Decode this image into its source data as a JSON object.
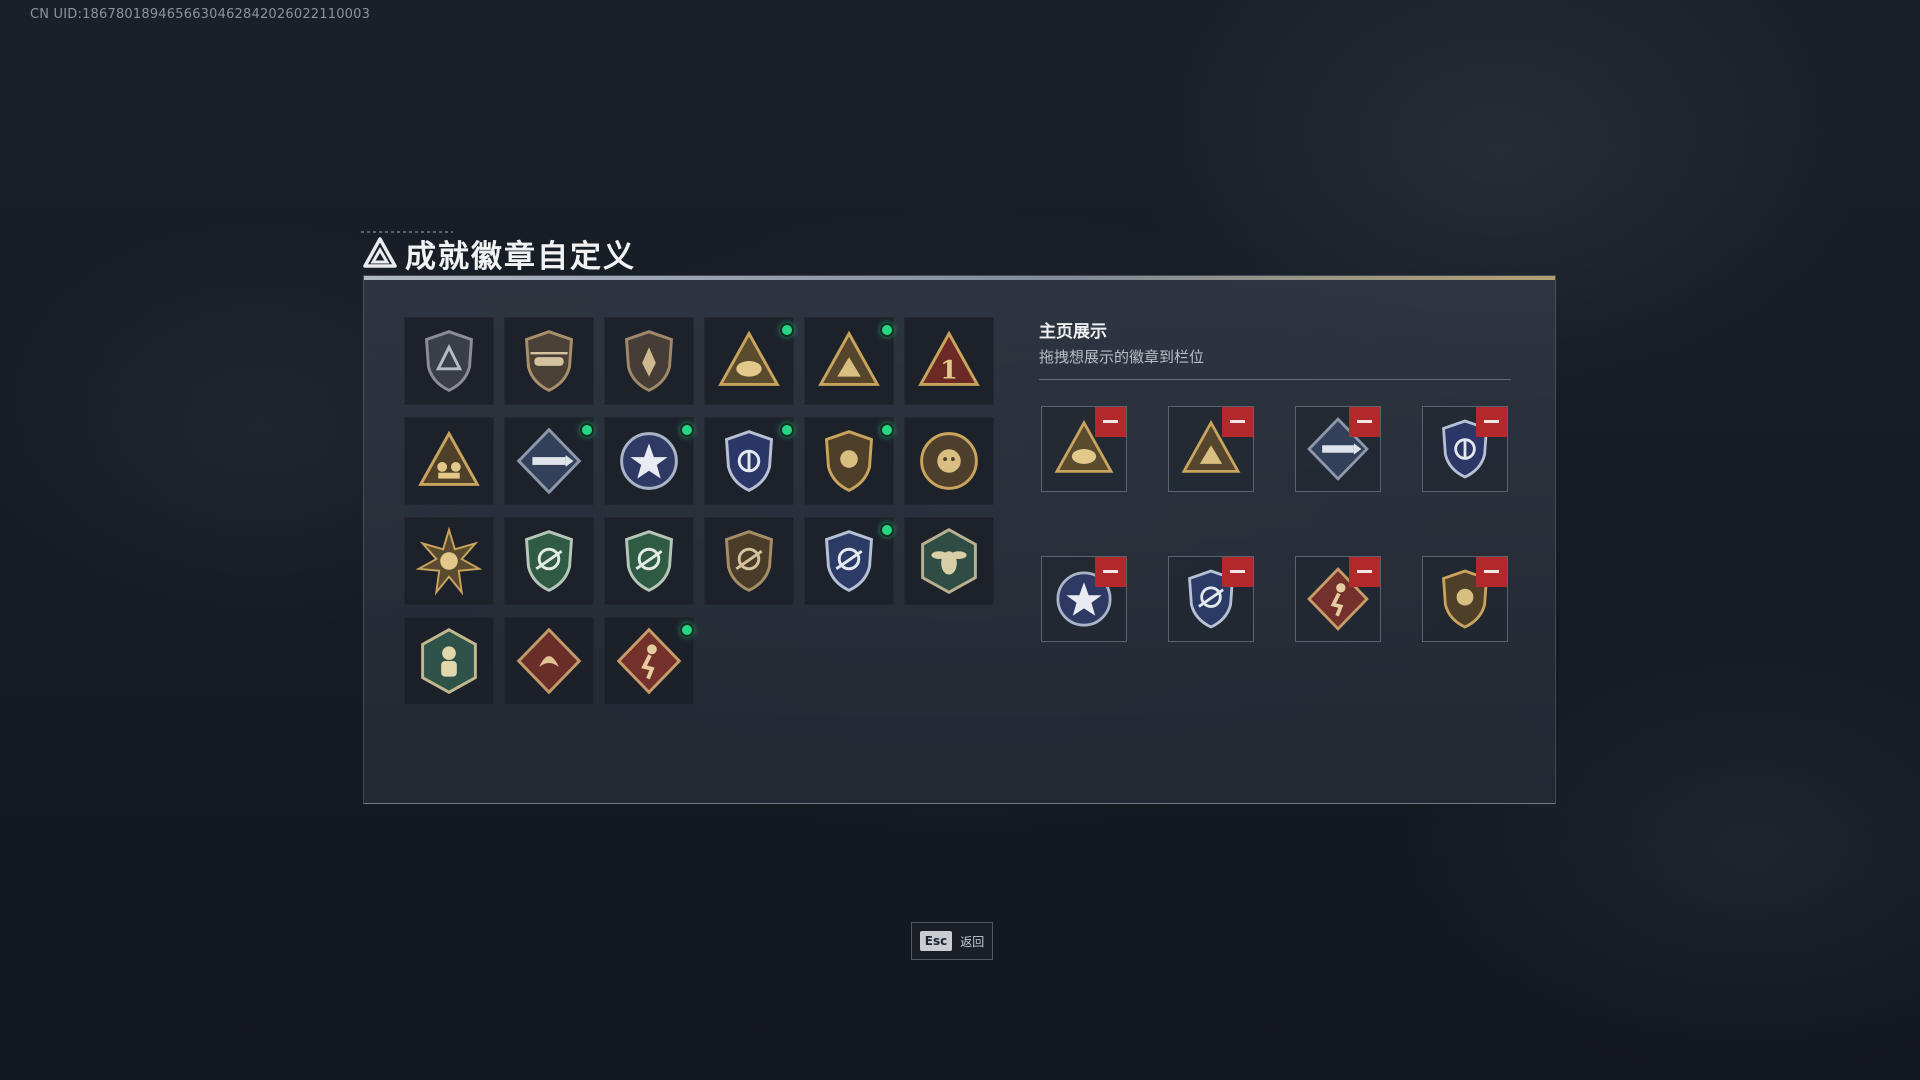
{
  "uid_text": "CN UID:1867801894656630462842026022110003",
  "header": {
    "title": "成就徽章自定义",
    "logo_icon": "triangle-logo-icon"
  },
  "colors": {
    "new_dot": "#27d685",
    "remove": "#b3282b",
    "gold": "#c9a45c",
    "steel": "#8d99ab"
  },
  "badge_grid": {
    "items": [
      {
        "icon": "shield-triangle-badge-icon",
        "new": false
      },
      {
        "icon": "helicopter-badge-icon",
        "new": false
      },
      {
        "icon": "shield-wings-badge-icon",
        "new": false
      },
      {
        "icon": "triangle-helmet-badge-icon",
        "new": true
      },
      {
        "icon": "triangle-soldier-badge-icon",
        "new": true
      },
      {
        "icon": "triangle-number-one-badge-icon",
        "new": false
      },
      {
        "icon": "triangle-squad-badge-icon",
        "new": false
      },
      {
        "icon": "diamond-rocket-badge-icon",
        "new": true
      },
      {
        "icon": "star-emblem-badge-icon",
        "new": true
      },
      {
        "icon": "blue-shield-emblem-badge-icon",
        "new": true
      },
      {
        "icon": "gold-shield-badge-icon",
        "new": true
      },
      {
        "icon": "round-beast-badge-icon",
        "new": false
      },
      {
        "icon": "sunburst-badge-icon",
        "new": false
      },
      {
        "icon": "green-shield-rifle-badge-icon",
        "new": false
      },
      {
        "icon": "green-shield-rifle-badge-icon",
        "new": false
      },
      {
        "icon": "bronze-shield-rifle-badge-icon",
        "new": false
      },
      {
        "icon": "blue-shield-rifle-badge-icon",
        "new": true
      },
      {
        "icon": "hexagon-wasp-badge-icon",
        "new": false
      },
      {
        "icon": "hexagon-figure-badge-icon",
        "new": false
      },
      {
        "icon": "diamond-dragon-badge-icon",
        "new": false
      },
      {
        "icon": "diamond-runner-badge-icon",
        "new": true
      }
    ]
  },
  "showcase": {
    "title": "主页展示",
    "subtitle": "拖拽想展示的徽章到栏位",
    "slots": [
      {
        "icon": "triangle-helmet-badge-icon"
      },
      {
        "icon": "triangle-soldier-badge-icon"
      },
      {
        "icon": "diamond-rocket-badge-icon"
      },
      {
        "icon": "blue-shield-emblem-badge-icon"
      },
      {
        "icon": "star-emblem-badge-icon"
      },
      {
        "icon": "blue-shield-rifle-badge-icon"
      },
      {
        "icon": "diamond-runner-badge-icon"
      },
      {
        "icon": "gold-shield-badge-icon"
      }
    ]
  },
  "footer": {
    "esc_key": "Esc",
    "esc_label": "返回"
  }
}
